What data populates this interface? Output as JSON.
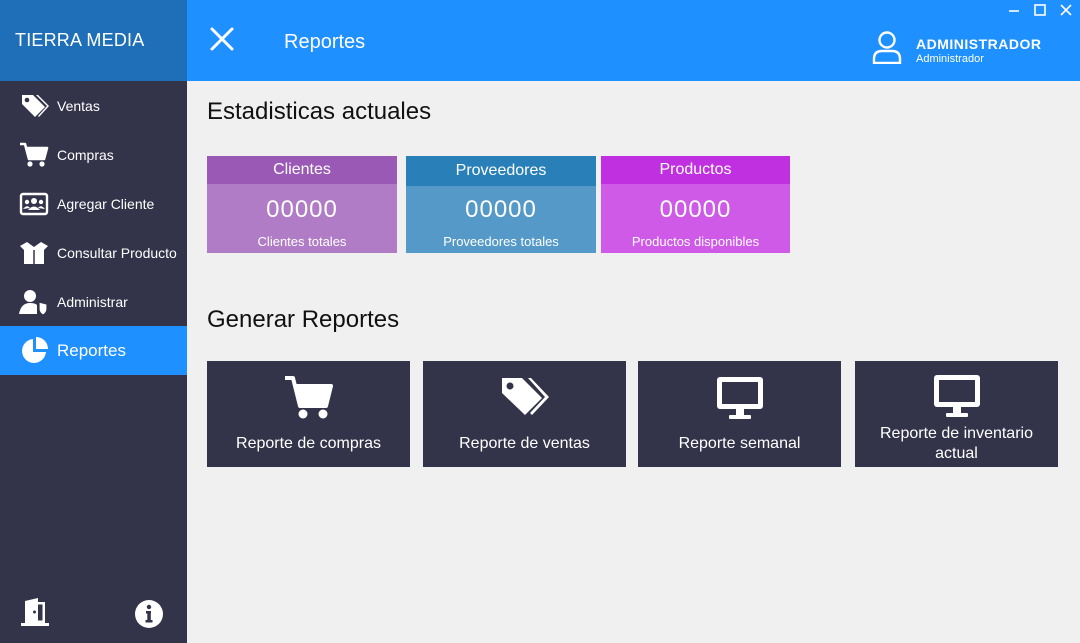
{
  "brand": "TIERRA MEDIA",
  "sidebar": {
    "items": [
      {
        "label": "Ventas",
        "icon": "tags-icon"
      },
      {
        "label": "Compras",
        "icon": "cart-icon"
      },
      {
        "label": "Agregar Cliente",
        "icon": "contact-card-icon"
      },
      {
        "label": "Consultar Producto",
        "icon": "open-box-icon"
      },
      {
        "label": "Administrar",
        "icon": "user-shield-icon"
      },
      {
        "label": "Reportes",
        "icon": "pie-chart-icon",
        "active": true
      }
    ],
    "bottom_icons": [
      "exit-door-icon",
      "info-icon"
    ]
  },
  "header": {
    "title": "Reportes",
    "user_name": "ADMINISTRADOR",
    "user_role": "Administrador"
  },
  "stats": {
    "title": "Estadisticas actuales",
    "cards": [
      {
        "header": "Clientes",
        "value": "00000",
        "footer": "Clientes totales",
        "header_color": "#9b59b6",
        "body_color": "#b07cc6"
      },
      {
        "header": "Proveedores",
        "value": "00000",
        "footer": "Proveedores totales",
        "header_color": "#2980b9",
        "body_color": "#5499c7"
      },
      {
        "header": "Productos",
        "value": "00000",
        "footer": "Productos disponibles",
        "header_color": "#c030e0",
        "body_color": "#cf5ae8"
      }
    ]
  },
  "reports": {
    "title": "Generar Reportes",
    "buttons": [
      {
        "label": "Reporte de compras",
        "icon": "cart-icon"
      },
      {
        "label": "Reporte de ventas",
        "icon": "tags-icon"
      },
      {
        "label": "Reporte semanal",
        "icon": "monitor-icon"
      },
      {
        "label": "Reporte de inventario actual",
        "icon": "monitor-icon"
      }
    ]
  },
  "colors": {
    "sidebar_bg": "#33334a",
    "brand_bg": "#1f6fb8",
    "header_bg": "#1e90ff",
    "active_item_bg": "#1e90ff",
    "content_bg": "#f0f0f0"
  }
}
